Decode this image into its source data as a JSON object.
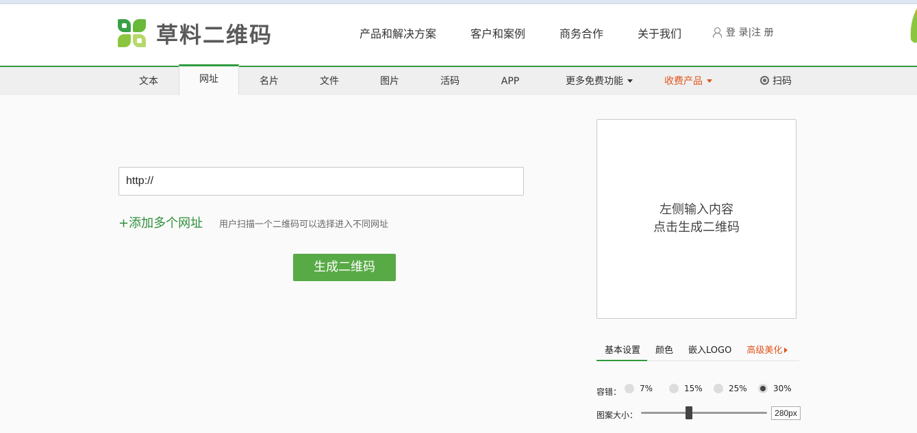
{
  "brand": {
    "name": "草料二维码"
  },
  "top_nav": {
    "items": [
      "产品和解决方案",
      "客户和案例",
      "商务合作",
      "关于我们"
    ],
    "login_register": "登 录|注 册"
  },
  "tabs": {
    "text": "文本",
    "url": "网址",
    "card": "名片",
    "file": "文件",
    "image": "图片",
    "live_code": "活码",
    "app": "APP",
    "more": "更多免费功能",
    "paid": "收费产品",
    "scan": "扫码",
    "active": "网址"
  },
  "form": {
    "url_value": "http://",
    "add_multiple": "+添加多个网址",
    "add_multiple_desc": "用户扫描一个二维码可以选择进入不同网址",
    "generate_button": "生成二维码"
  },
  "preview": {
    "line1": "左侧输入内容",
    "line2": "点击生成二维码"
  },
  "settings": {
    "tabs": [
      "基本设置",
      "颜色",
      "嵌入LOGO",
      "高级美化"
    ],
    "active_tab": "基本设置",
    "error_correction_label": "容错：",
    "error_correction_options": [
      "7%",
      "15%",
      "25%",
      "30%"
    ],
    "error_correction_selected": "30%",
    "size_label": "图案大小：",
    "size_value": "280px"
  },
  "colors": {
    "brand_green": "#2f9a3c",
    "button_green": "#58aa46",
    "accent_orange": "#e2541c"
  }
}
